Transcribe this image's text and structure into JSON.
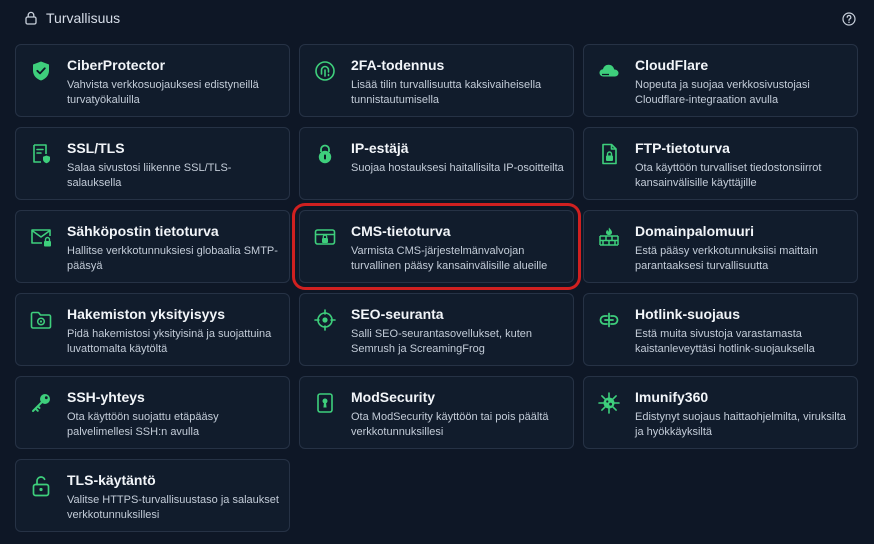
{
  "header": {
    "title": "Turvallisuus"
  },
  "colors": {
    "accent": "#3ecf7c",
    "selection": "#d02020",
    "card_bg": "#111c2c",
    "page_bg": "#0e1726"
  },
  "cards": [
    {
      "title": "CiberProtector",
      "desc": "Vahvista verkkosuojauksesi edistyneillä turvatyökaluilla",
      "icon": "shield-check-icon"
    },
    {
      "title": "2FA-todennus",
      "desc": "Lisää tilin turvallisuutta kaksivaiheisella tunnistautumisella",
      "icon": "fingerprint-icon"
    },
    {
      "title": "CloudFlare",
      "desc": "Nopeuta ja suojaa verkkosivustojasi Cloudflare-integraation avulla",
      "icon": "cloud-icon"
    },
    {
      "title": "SSL/TLS",
      "desc": "Salaa sivustosi liikenne SSL/TLS-salauksella",
      "icon": "certificate-icon"
    },
    {
      "title": "IP-estäjä",
      "desc": "Suojaa hostauksesi haitallisilta IP-osoitteilta",
      "icon": "ip-block-icon"
    },
    {
      "title": "FTP-tietoturva",
      "desc": "Ota käyttöön turvalliset tiedostonsiirrot kansainvälisille käyttäjille",
      "icon": "file-lock-icon"
    },
    {
      "title": "Sähköpostin tietoturva",
      "desc": "Hallitse verkkotunnuksiesi globaalia SMTP-pääsyä",
      "icon": "mail-lock-icon"
    },
    {
      "title": "CMS-tietoturva",
      "desc": "Varmista CMS-järjestelmänvalvojan turvallinen pääsy kansainvälisille alueille",
      "icon": "window-lock-icon"
    },
    {
      "title": "Domainpalomuuri",
      "desc": "Estä pääsy verkkotunnuksiisi maittain parantaaksesi turvallisuutta",
      "icon": "firewall-icon"
    },
    {
      "title": "Hakemiston yksityisyys",
      "desc": "Pidä hakemistosi yksityisinä ja suojattuina luvattomalta käytöltä",
      "icon": "folder-lock-icon"
    },
    {
      "title": "SEO-seuranta",
      "desc": "Salli SEO-seurantasovellukset, kuten Semrush ja ScreamingFrog",
      "icon": "crosshair-icon"
    },
    {
      "title": "Hotlink-suojaus",
      "desc": "Estä muita sivustoja varastamasta kaistanleveyttäsi hotlink-suojauksella",
      "icon": "link-block-icon"
    },
    {
      "title": "SSH-yhteys",
      "desc": "Ota käyttöön suojattu etäpääsy palvelimellesi SSH:n avulla",
      "icon": "key-icon"
    },
    {
      "title": "ModSecurity",
      "desc": "Ota ModSecurity käyttöön tai pois päältä verkkotunnuksillesi",
      "icon": "keyhole-icon"
    },
    {
      "title": "Imunify360",
      "desc": "Edistynyt suojaus haittaohjelmilta, viruksilta ja hyökkäyksiltä",
      "icon": "virus-icon"
    },
    {
      "title": "TLS-käytäntö",
      "desc": "Valitse HTTPS-turvallisuustaso ja salaukset verkkotunnuksillesi",
      "icon": "unlock-icon"
    }
  ]
}
